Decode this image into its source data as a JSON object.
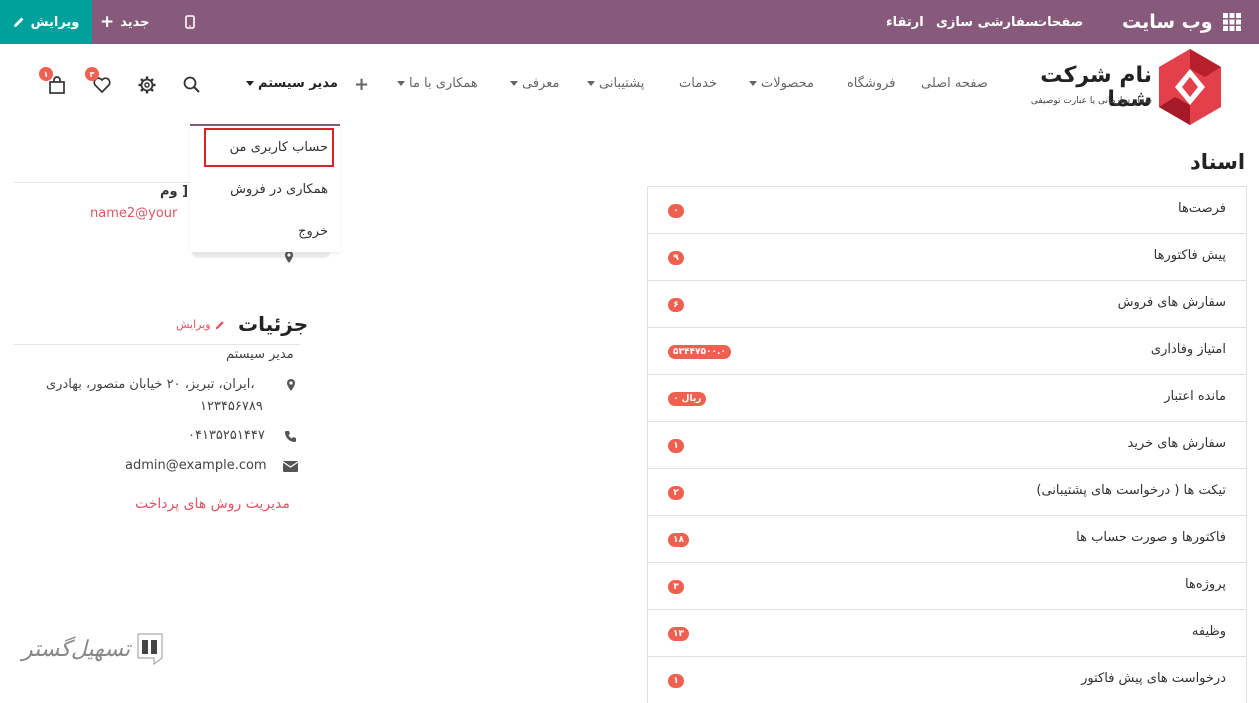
{
  "adminbar": {
    "edit_label": "ویرایش",
    "new_label": "جدید",
    "menu": [
      "صفحات",
      "سفارشی سازی",
      "ارتقاء"
    ],
    "site_title": "وب سایت"
  },
  "header": {
    "logo_name": "نام شرکت شما",
    "logo_tagline": "شعار سازمانی یا عبارت توصیفی",
    "nav": [
      "صفحه اصلی",
      "فروشگاه",
      "محصولات",
      "خدمات",
      "پشتیبانی",
      "معرفی",
      "همکاری با ما"
    ],
    "user_menu": "مدیر سیستم",
    "wishlist_count": "۳",
    "cart_count": "۱"
  },
  "user_dropdown": {
    "items": [
      "حساب کاربری من",
      "همکاری در فروش",
      "خروج"
    ]
  },
  "profile": {
    "partial_name": "وم ]",
    "partial_email": "name2@your",
    "details_title": "جزئیات",
    "details_edit": "ویرایش",
    "name": "مدیر سیستم",
    "address_line1": "ایران، تبریز، ۲۰ خیابان منصور، بهادری،",
    "address_line2": "۱۲۳۴۵۶۷۸۹",
    "phone": "۰۴۱۳۵۲۵۱۴۴۷",
    "email": "admin@example.com",
    "payment_link": "مدیریت روش های پرداخت"
  },
  "documents": {
    "title": "اسناد",
    "rows": [
      {
        "label": "فرصت‌ها",
        "badge": "۰"
      },
      {
        "label": "پیش فاکتورها",
        "badge": "۹"
      },
      {
        "label": "سفارش های فروش",
        "badge": "۶"
      },
      {
        "label": "امتیاز وفاداری",
        "badge": "۵۳۴۴۷۵۰۰.۰"
      },
      {
        "label": "مانده اعتبار",
        "badge": "۰ ریال"
      },
      {
        "label": "سفارش های خرید",
        "badge": "۱"
      },
      {
        "label": "تیکت ها ( درخواست های پشتیبانی)",
        "badge": "۲"
      },
      {
        "label": "فاکتورها و صورت حساب ها",
        "badge": "۱۸"
      },
      {
        "label": "پروژه‌ها",
        "badge": "۳"
      },
      {
        "label": "وظیفه",
        "badge": "۱۳"
      },
      {
        "label": "درخواست های پیش فاکتور",
        "badge": "۱"
      }
    ]
  },
  "watermark": {
    "text": "تسهیل‌گستر"
  },
  "colors": {
    "admin_bar": "#875a7b",
    "edit_button": "#00a09d",
    "accent_red": "#f06050",
    "link": "#e05564",
    "highlight": "#d8232a"
  }
}
